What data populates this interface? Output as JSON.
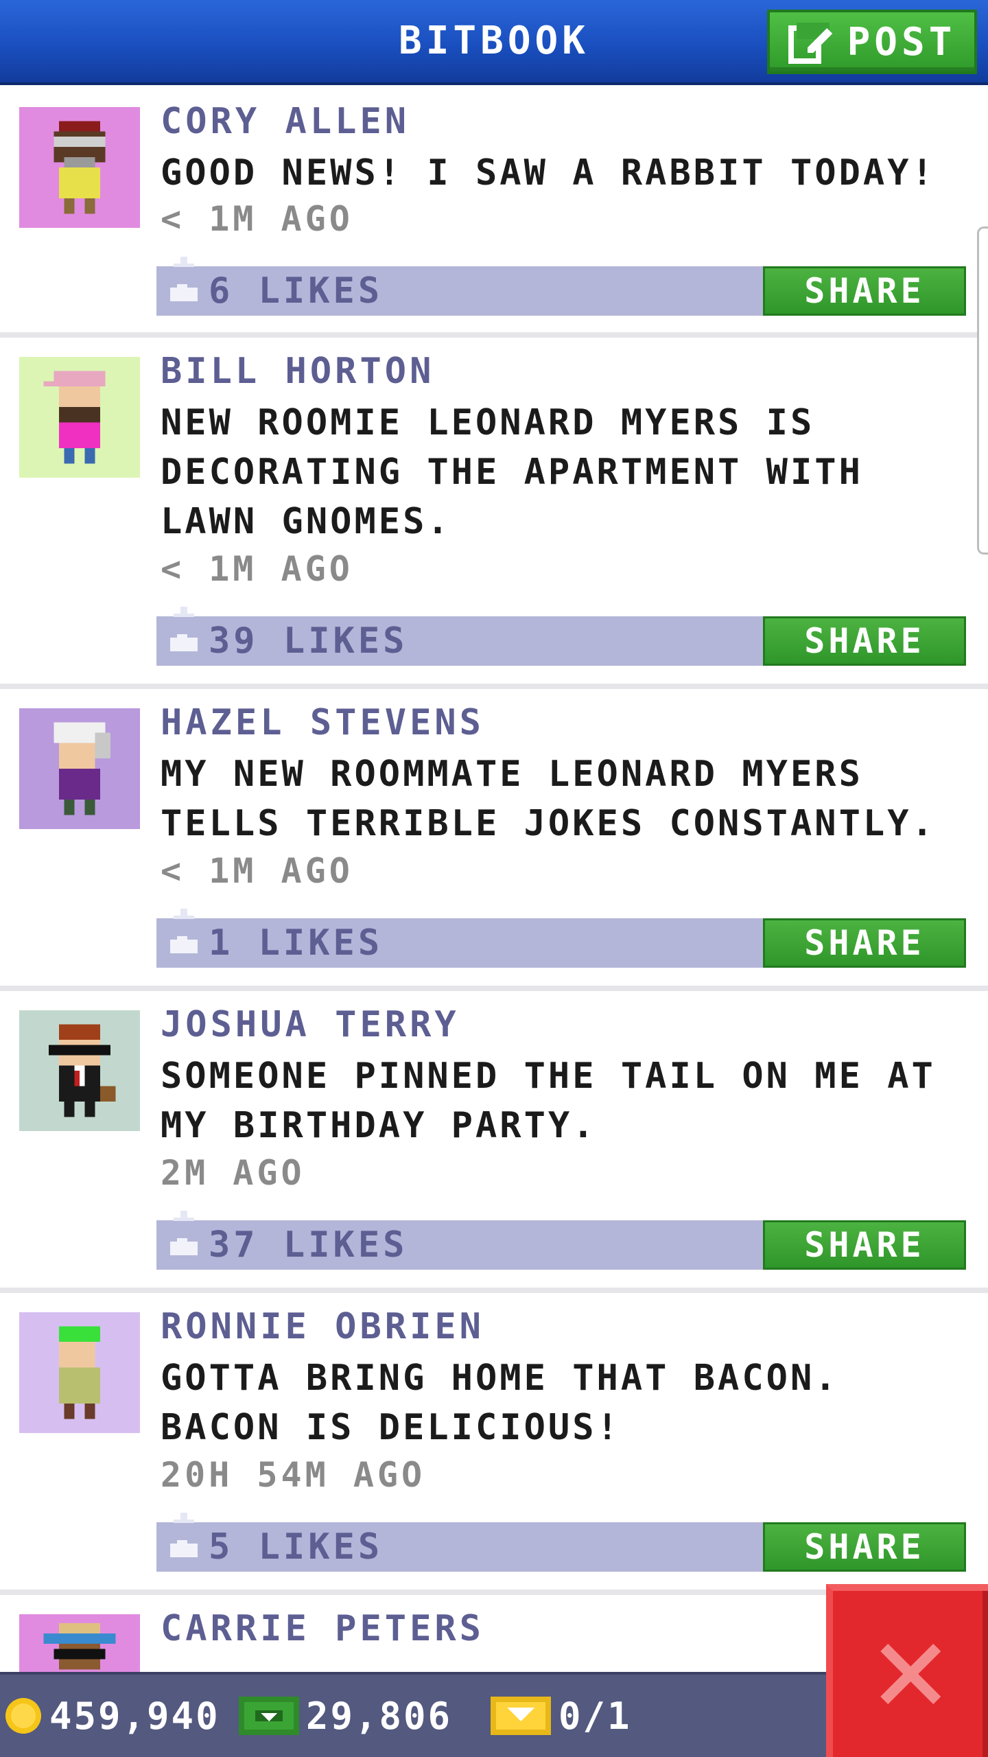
{
  "header": {
    "title": "BITBOOK",
    "post_label": "POST"
  },
  "posts": [
    {
      "author": "CORY ALLEN",
      "message": "GOOD NEWS! I SAW A RABBIT TODAY!",
      "time": "< 1M AGO",
      "likes": "6 LIKES",
      "share_label": "SHARE",
      "avatar_bg": "#e08be0"
    },
    {
      "author": "BILL HORTON",
      "message": "NEW ROOMIE LEONARD MYERS IS DECORATING THE APARTMENT WITH LAWN GNOMES.",
      "time": "< 1M AGO",
      "likes": "39 LIKES",
      "share_label": "SHARE",
      "avatar_bg": "#dcf5b4"
    },
    {
      "author": "HAZEL STEVENS",
      "message": "MY NEW ROOMMATE LEONARD MYERS TELLS TERRIBLE JOKES CONSTANTLY.",
      "time": "< 1M AGO",
      "likes": "1 LIKES",
      "share_label": "SHARE",
      "avatar_bg": "#b89add"
    },
    {
      "author": "JOSHUA TERRY",
      "message": "SOMEONE PINNED THE TAIL ON ME AT MY BIRTHDAY PARTY.",
      "time": "2M AGO",
      "likes": "37 LIKES",
      "share_label": "SHARE",
      "avatar_bg": "#c2d8ce"
    },
    {
      "author": "RONNIE OBRIEN",
      "message": "GOTTA BRING HOME THAT BACON. BACON IS DELICIOUS!",
      "time": "20H 54M AGO",
      "likes": "5 LIKES",
      "share_label": "SHARE",
      "avatar_bg": "#d6bff0"
    },
    {
      "author": "CARRIE PETERS",
      "avatar_bg": "#e08be0"
    }
  ],
  "status": {
    "coins": "459,940",
    "bux": "29,806",
    "tickets": "0/1"
  },
  "colors": {
    "header_blue": "#1a4fbf",
    "share_green": "#3aa535",
    "likes_bar": "#b3b6d8",
    "author_text": "#5d5e92",
    "close_red": "#e3282d",
    "status_bar": "#53597f"
  },
  "icons": {
    "post": "edit-icon",
    "like": "thumbs-up-icon",
    "coin": "coin-icon",
    "bux": "bux-icon",
    "ticket": "ticket-icon",
    "close": "close-icon"
  }
}
